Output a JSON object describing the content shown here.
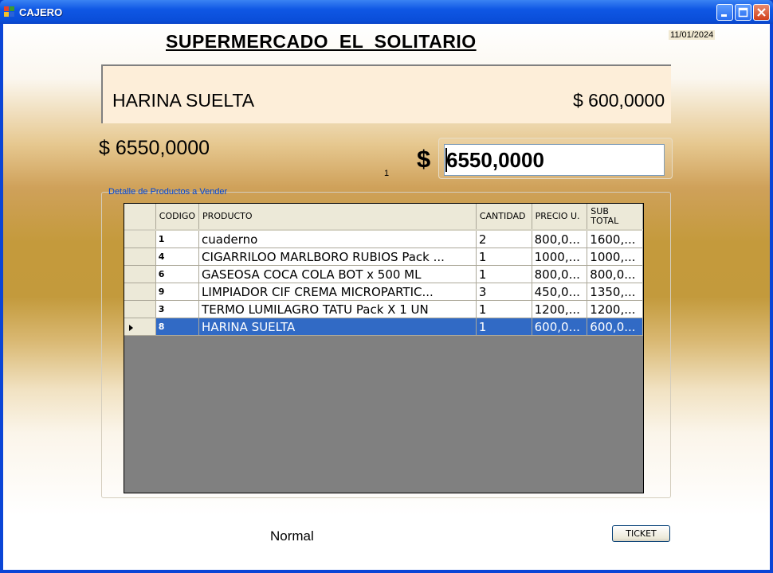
{
  "window": {
    "title": "CAJERO",
    "controls": [
      "minimize-icon",
      "maximize-icon",
      "close-icon"
    ]
  },
  "header": {
    "store_name": "SUPERMERCADO  EL  SOLITARIO",
    "date": "11/01/2024"
  },
  "current_product": {
    "name": "HARINA SUELTA",
    "price": "$ 600,0000"
  },
  "totals": {
    "total_label": "$ 6550,0000",
    "count": "1",
    "currency_symbol": "$",
    "total_value": "6550,0000"
  },
  "detail": {
    "group_title": "Detalle de Productos a Vender",
    "columns": {
      "codigo": "CODIGO",
      "producto": "PRODUCTO",
      "cantidad": "CANTIDAD",
      "precio": "PRECIO U.",
      "subtotal": "SUB TOTAL"
    },
    "rows": [
      {
        "codigo": "1",
        "producto": "cuaderno",
        "cantidad": "2",
        "precio": "800,0...",
        "subtotal": "1600,..."
      },
      {
        "codigo": "4",
        "producto": "CIGARRILOO MARLBORO RUBIOS Pack ...",
        "cantidad": "1",
        "precio": "1000,...",
        "subtotal": "1000,..."
      },
      {
        "codigo": "6",
        "producto": "GASEOSA COCA COLA  BOT x 500 ML",
        "cantidad": "1",
        "precio": "800,0...",
        "subtotal": "800,0..."
      },
      {
        "codigo": "9",
        "producto": "LIMPIADOR CIF CREMA MICROPARTIC...",
        "cantidad": "3",
        "precio": "450,0...",
        "subtotal": "1350,..."
      },
      {
        "codigo": "3",
        "producto": "TERMO LUMILAGRO TATU Pack X 1 UN",
        "cantidad": "1",
        "precio": "1200,...",
        "subtotal": "1200,..."
      },
      {
        "codigo": "8",
        "producto": "HARINA SUELTA",
        "cantidad": "1",
        "precio": "600,0...",
        "subtotal": "600,0..."
      }
    ],
    "selected_row": 5
  },
  "footer": {
    "status": "Normal",
    "ticket_label": "TICKET"
  },
  "colors": {
    "titlebar": "#0a4ed9",
    "selection": "#316ac5",
    "product_panel": "#fdeed9",
    "grid_background": "#808080"
  }
}
